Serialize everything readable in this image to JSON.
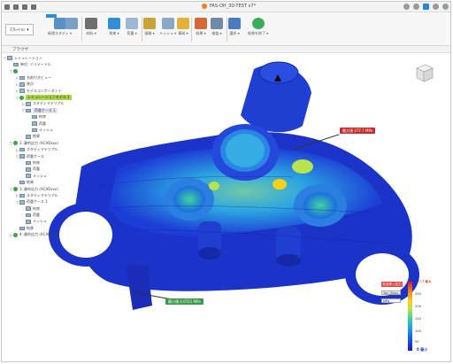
{
  "title_bar": {
    "document_title": "FAS-OH_3D-TEST v7*",
    "icons": [
      "file-icon",
      "save-icon",
      "undo-icon",
      "redo-icon"
    ]
  },
  "ribbon": {
    "workspace_label": "ﾏﾌﾚｰｼｮﾝ ▾",
    "tab_active": "解析",
    "tools": [
      {
        "name": "study-tool",
        "label": "新規スタディ ▾",
        "active": false
      },
      {
        "name": "simplify-tool",
        "label": "",
        "active": false
      },
      {
        "name": "material-tool",
        "label": "材料 ▾",
        "active": false
      },
      {
        "name": "constraint-tool",
        "label": "拘束 ▾",
        "active": true
      },
      {
        "name": "load-tool",
        "label": "荷重 ▾",
        "active": false
      },
      {
        "name": "contact-tool",
        "label": "接触 ▾",
        "active": false
      },
      {
        "name": "mesh-tool",
        "label": "メッシュ ▾",
        "active": false
      },
      {
        "name": "precheck-tool",
        "label": "事前 ▾",
        "active": false
      },
      {
        "name": "result-tool",
        "label": "結果 ▾",
        "active": false
      },
      {
        "name": "inspect-tool",
        "label": "検査 ▾",
        "active": false
      },
      {
        "name": "select-tool",
        "label": "選択 ▾",
        "active": false
      },
      {
        "name": "finish-tool",
        "label": "結果を終了 ▾",
        "active": false
      }
    ]
  },
  "browser": {
    "header": "ブラウザ",
    "rows": [
      {
        "indent": 0,
        "label": "シミュレーション",
        "arrow": "▽",
        "kind": "box"
      },
      {
        "indent": 1,
        "label": "単位: ミリメートル",
        "arrow": "",
        "kind": "box"
      },
      {
        "indent": 1,
        "label": "",
        "arrow": "▽",
        "kind": "ck",
        "highlight": "alt"
      },
      {
        "indent": 2,
        "label": "名前付きビュー",
        "arrow": "▷",
        "kind": "box"
      },
      {
        "indent": 2,
        "label": "原点",
        "arrow": "▷",
        "kind": "box"
      },
      {
        "indent": 2,
        "label": "モデルコンポーネント",
        "arrow": "▷",
        "kind": "box"
      },
      {
        "indent": 2,
        "label": "シミュレーションモデル 1",
        "arrow": "▽",
        "kind": "ck",
        "highlight": "main"
      },
      {
        "indent": 3,
        "label": "スタディマテリアル",
        "arrow": "▷",
        "kind": "box"
      },
      {
        "indent": 3,
        "label": "荷重ケース 1",
        "arrow": "▽",
        "kind": "box",
        "highlight": "alt"
      },
      {
        "indent": 4,
        "label": "拘束",
        "arrow": "",
        "kind": "box"
      },
      {
        "indent": 4,
        "label": "荷重",
        "arrow": "",
        "kind": "box"
      },
      {
        "indent": 4,
        "label": "メッシュ",
        "arrow": "",
        "kind": "box"
      },
      {
        "indent": 3,
        "label": "結果",
        "arrow": "",
        "kind": "box"
      },
      {
        "indent": 1,
        "label": "2: 静的応力 (ACADxxx)",
        "arrow": "▽",
        "kind": "ck"
      },
      {
        "indent": 2,
        "label": "スタディマテリアル",
        "arrow": "▷",
        "kind": "box"
      },
      {
        "indent": 2,
        "label": "荷重ケース",
        "arrow": "▽",
        "kind": "box"
      },
      {
        "indent": 3,
        "label": "拘束",
        "arrow": "",
        "kind": "box"
      },
      {
        "indent": 3,
        "label": "荷重",
        "arrow": "",
        "kind": "box"
      },
      {
        "indent": 3,
        "label": "メッシュ",
        "arrow": "",
        "kind": "box"
      },
      {
        "indent": 2,
        "label": "結果",
        "arrow": "",
        "kind": "box"
      },
      {
        "indent": 1,
        "label": "3: 静的応力 (ACADxxx)",
        "arrow": "▽",
        "kind": "ck"
      },
      {
        "indent": 2,
        "label": "スタディマテリアル",
        "arrow": "▷",
        "kind": "box"
      },
      {
        "indent": 2,
        "label": "荷重ケース 1",
        "arrow": "▽",
        "kind": "box"
      },
      {
        "indent": 3,
        "label": "拘束",
        "arrow": "",
        "kind": "box"
      },
      {
        "indent": 3,
        "label": "荷重",
        "arrow": "",
        "kind": "box"
      },
      {
        "indent": 3,
        "label": "メッシュ",
        "arrow": "",
        "kind": "box"
      },
      {
        "indent": 2,
        "label": "結果",
        "arrow": "",
        "kind": "box"
      },
      {
        "indent": 1,
        "label": "4: 静的応力 (ACADxxx)",
        "arrow": "▷",
        "kind": "ck"
      }
    ]
  },
  "viewport": {
    "max_probe": "最大値 277.7 MPa",
    "min_probe": "最小値 0.0721 MPa",
    "view_cube_icon": "view-cube-icon"
  },
  "legend": {
    "header": "安全率 / 応力",
    "max_label": "277.7 最大",
    "ticks": [
      "250",
      "200",
      "150",
      "100",
      "50"
    ],
    "min_label": "0 最小",
    "dropdowns": [
      "Von Mises",
      "MPa"
    ],
    "colors": {
      "high": "#d7191c",
      "mid": "#3fd49e",
      "low": "#1a1ad0"
    }
  },
  "colors": {
    "accent": "#2e8fd6",
    "check": "#3aa44a",
    "highlight": "#a9d83f"
  }
}
